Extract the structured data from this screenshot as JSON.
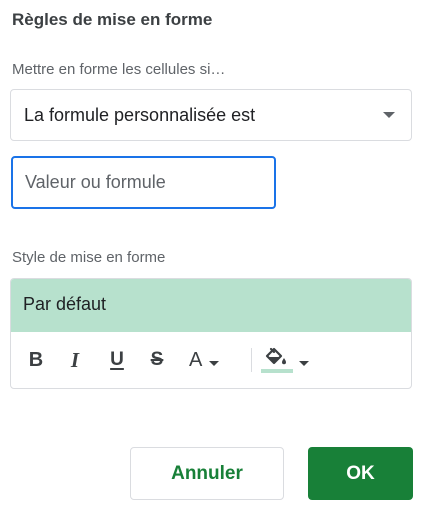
{
  "panel": {
    "title": "Règles de mise en forme"
  },
  "condition": {
    "label": "Mettre en forme les cellules si…",
    "selected": "La formule personnalisée est",
    "value_input": {
      "value": "",
      "placeholder": "Valeur ou formule"
    }
  },
  "style": {
    "label": "Style de mise en forme",
    "preview_text": "Par défaut",
    "preview_background": "#b7e1cd",
    "fill_color": "#b7e1cd",
    "toolbar": {
      "bold": "B",
      "italic": "I",
      "underline": "U",
      "strikethrough": "S",
      "text_color": "A",
      "icons": [
        "bold-icon",
        "italic-icon",
        "underline-icon",
        "strikethrough-icon",
        "text-color-icon",
        "fill-color-icon"
      ]
    }
  },
  "actions": {
    "cancel_label": "Annuler",
    "ok_label": "OK"
  },
  "colors": {
    "accent_green": "#188038",
    "focus_blue": "#1a73e8"
  }
}
